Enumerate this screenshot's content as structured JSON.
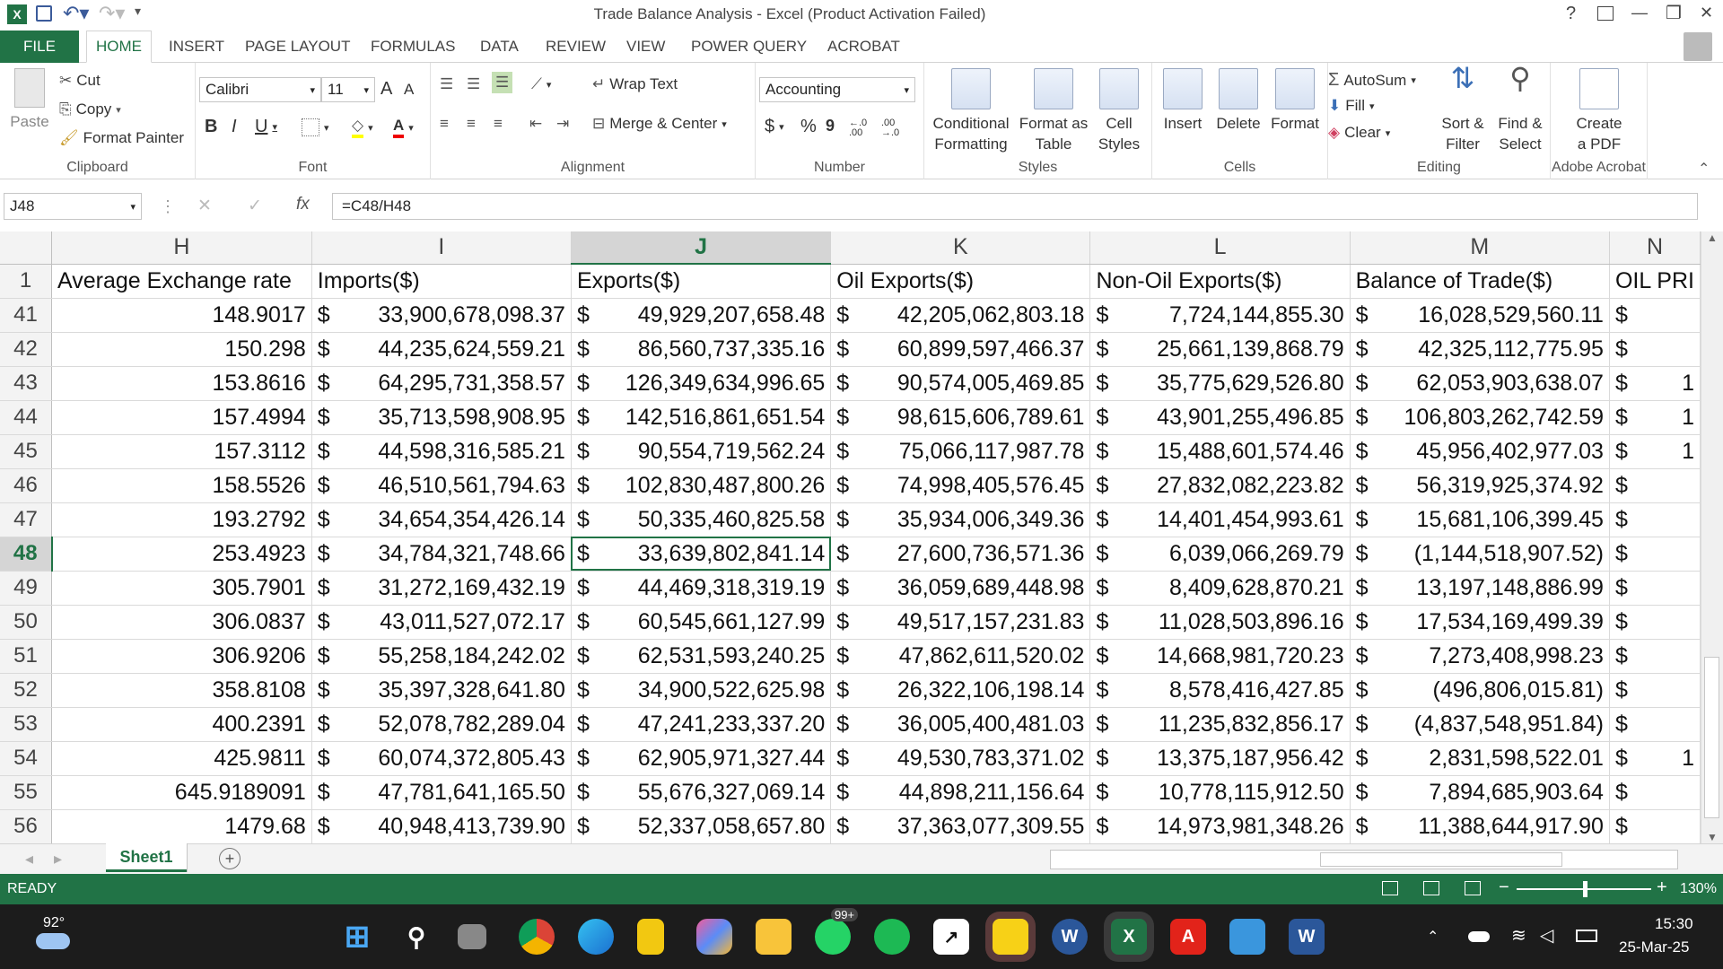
{
  "window": {
    "title": "Trade Balance Analysis - Excel (Product Activation Failed)",
    "help": "?",
    "minimize": "—",
    "restore": "❐",
    "close": "✕"
  },
  "ribbon_tabs": {
    "file": "FILE",
    "home": "HOME",
    "insert": "INSERT",
    "page_layout": "PAGE LAYOUT",
    "formulas": "FORMULAS",
    "data": "DATA",
    "review": "REVIEW",
    "view": "VIEW",
    "power_query": "POWER QUERY",
    "acrobat": "ACROBAT"
  },
  "clipboard": {
    "paste": "Paste",
    "cut": "Cut",
    "copy": "Copy",
    "format_painter": "Format Painter",
    "label": "Clipboard"
  },
  "font": {
    "name": "Calibri",
    "size": "11",
    "label": "Font",
    "bold": "B",
    "italic": "I",
    "underline": "U",
    "grow": "A",
    "shrink": "A"
  },
  "alignment": {
    "wrap_text": "Wrap Text",
    "merge_center": "Merge & Center",
    "label": "Alignment"
  },
  "number": {
    "format": "Accounting",
    "currency": "$",
    "percent": "%",
    "comma": "9",
    "inc_decimal": "←.0 .00",
    "dec_decimal": ".00 →.0",
    "label": "Number"
  },
  "styles": {
    "conditional_formatting": [
      "Conditional",
      "Formatting"
    ],
    "format_as_table": [
      "Format as",
      "Table"
    ],
    "cell_styles": [
      "Cell",
      "Styles"
    ],
    "label": "Styles"
  },
  "cells": {
    "insert": "Insert",
    "delete": "Delete",
    "format": "Format",
    "label": "Cells"
  },
  "editing": {
    "autosum": "AutoSum",
    "fill": "Fill",
    "clear": "Clear",
    "sort_filter": [
      "Sort &",
      "Filter"
    ],
    "find_select": [
      "Find &",
      "Select"
    ],
    "label": "Editing"
  },
  "acrobat": {
    "create_pdf": [
      "Create",
      "a PDF"
    ],
    "label": "Adobe Acrobat"
  },
  "formula_bar": {
    "name_box": "J48",
    "formula": "=C48/H48",
    "fx": "fx",
    "cancel": "✕",
    "enter": "✓"
  },
  "columns": [
    "H",
    "I",
    "J",
    "K",
    "L",
    "M",
    "N"
  ],
  "selected_column": "J",
  "header_row": {
    "row": "1",
    "cells": [
      "Average Exchange rate",
      "Imports($)",
      "Exports($)",
      "Oil Exports($)",
      "Non-Oil Exports($)",
      "Balance of Trade($)",
      "OIL PRI"
    ]
  },
  "rows": [
    {
      "row": "41",
      "h": "148.9017",
      "i": "33,900,678,098.37",
      "j": "49,929,207,658.48",
      "k": "42,205,062,803.18",
      "l": "7,724,144,855.30",
      "m": "16,028,529,560.11",
      "n": ""
    },
    {
      "row": "42",
      "h": "150.298",
      "i": "44,235,624,559.21",
      "j": "86,560,737,335.16",
      "k": "60,899,597,466.37",
      "l": "25,661,139,868.79",
      "m": "42,325,112,775.95",
      "n": ""
    },
    {
      "row": "43",
      "h": "153.8616",
      "i": "64,295,731,358.57",
      "j": "126,349,634,996.65",
      "k": "90,574,005,469.85",
      "l": "35,775,629,526.80",
      "m": "62,053,903,638.07",
      "n": "1"
    },
    {
      "row": "44",
      "h": "157.4994",
      "i": "35,713,598,908.95",
      "j": "142,516,861,651.54",
      "k": "98,615,606,789.61",
      "l": "43,901,255,496.85",
      "m": "106,803,262,742.59",
      "n": "1"
    },
    {
      "row": "45",
      "h": "157.3112",
      "i": "44,598,316,585.21",
      "j": "90,554,719,562.24",
      "k": "75,066,117,987.78",
      "l": "15,488,601,574.46",
      "m": "45,956,402,977.03",
      "n": "1"
    },
    {
      "row": "46",
      "h": "158.5526",
      "i": "46,510,561,794.63",
      "j": "102,830,487,800.26",
      "k": "74,998,405,576.45",
      "l": "27,832,082,223.82",
      "m": "56,319,925,374.92",
      "n": ""
    },
    {
      "row": "47",
      "h": "193.2792",
      "i": "34,654,354,426.14",
      "j": "50,335,460,825.58",
      "k": "35,934,006,349.36",
      "l": "14,401,454,993.61",
      "m": "15,681,106,399.45",
      "n": ""
    },
    {
      "row": "48",
      "h": "253.4923",
      "i": "34,784,321,748.66",
      "j": "33,639,802,841.14",
      "k": "27,600,736,571.36",
      "l": "6,039,066,269.79",
      "m": "(1,144,518,907.52)",
      "n": ""
    },
    {
      "row": "49",
      "h": "305.7901",
      "i": "31,272,169,432.19",
      "j": "44,469,318,319.19",
      "k": "36,059,689,448.98",
      "l": "8,409,628,870.21",
      "m": "13,197,148,886.99",
      "n": ""
    },
    {
      "row": "50",
      "h": "306.0837",
      "i": "43,011,527,072.17",
      "j": "60,545,661,127.99",
      "k": "49,517,157,231.83",
      "l": "11,028,503,896.16",
      "m": "17,534,169,499.39",
      "n": ""
    },
    {
      "row": "51",
      "h": "306.9206",
      "i": "55,258,184,242.02",
      "j": "62,531,593,240.25",
      "k": "47,862,611,520.02",
      "l": "14,668,981,720.23",
      "m": "7,273,408,998.23",
      "n": ""
    },
    {
      "row": "52",
      "h": "358.8108",
      "i": "35,397,328,641.80",
      "j": "34,900,522,625.98",
      "k": "26,322,106,198.14",
      "l": "8,578,416,427.85",
      "m": "(496,806,015.81)",
      "n": ""
    },
    {
      "row": "53",
      "h": "400.2391",
      "i": "52,078,782,289.04",
      "j": "47,241,233,337.20",
      "k": "36,005,400,481.03",
      "l": "11,235,832,856.17",
      "m": "(4,837,548,951.84)",
      "n": ""
    },
    {
      "row": "54",
      "h": "425.9811",
      "i": "60,074,372,805.43",
      "j": "62,905,971,327.44",
      "k": "49,530,783,371.02",
      "l": "13,375,187,956.42",
      "m": "2,831,598,522.01",
      "n": "1"
    },
    {
      "row": "55",
      "h": "645.9189091",
      "i": "47,781,641,165.50",
      "j": "55,676,327,069.14",
      "k": "44,898,211,156.64",
      "l": "10,778,115,912.50",
      "m": "7,894,685,903.64",
      "n": ""
    },
    {
      "row": "56",
      "h": "1479.68",
      "i": "40,948,413,739.90",
      "j": "52,337,058,657.80",
      "k": "37,363,077,309.55",
      "l": "14,973,981,348.26",
      "m": "11,388,644,917.90",
      "n": ""
    }
  ],
  "currency_symbol": "$",
  "sheet_tabs": [
    "Sheet1"
  ],
  "add_sheet": "+",
  "status": {
    "mode": "READY",
    "zoom": "130%"
  },
  "taskbar": {
    "weather_temp": "92°",
    "time": "15:30",
    "date": "25-Mar-25",
    "whatsapp_badge": "99+"
  },
  "colors": {
    "excel_green": "#217346",
    "selection": "#217346"
  }
}
